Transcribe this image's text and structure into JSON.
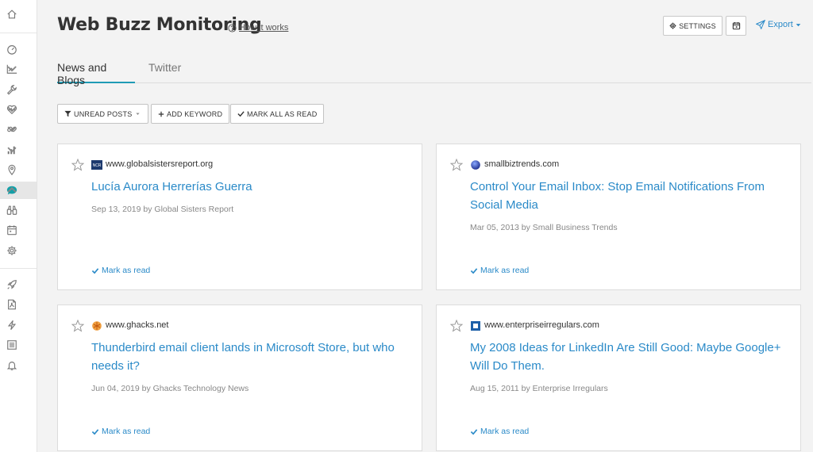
{
  "header": {
    "title": "Web Buzz Monitoring",
    "how_it_works": "How it works",
    "settings_label": "SETTINGS",
    "export_label": "Export"
  },
  "tabs": [
    {
      "label": "News and Blogs",
      "active": true
    },
    {
      "label": "Twitter",
      "active": false
    }
  ],
  "toolbar": {
    "filter_label": "UNREAD POSTS",
    "add_keyword_label": "ADD KEYWORD",
    "mark_all_label": "MARK ALL AS READ"
  },
  "sidebar": {
    "items": [
      {
        "icon": "home-icon"
      },
      {
        "icon": "dashboard-icon"
      },
      {
        "icon": "trend-chart-icon"
      },
      {
        "icon": "wrench-icon"
      },
      {
        "icon": "heart-pulse-icon"
      },
      {
        "icon": "link-icon"
      },
      {
        "icon": "bar-chart-icon"
      },
      {
        "icon": "map-pin-icon"
      },
      {
        "icon": "chat-bubble-icon",
        "active": true
      },
      {
        "icon": "binoculars-icon"
      },
      {
        "icon": "calendar-icon"
      },
      {
        "icon": "gear-icon"
      },
      {
        "icon": "rocket-icon"
      },
      {
        "icon": "pdf-icon"
      },
      {
        "icon": "bolt-icon"
      },
      {
        "icon": "list-icon"
      },
      {
        "icon": "bell-icon"
      }
    ]
  },
  "posts": [
    {
      "domain": "www.globalsistersreport.org",
      "favicon_text": "NCR",
      "title": "Lucía Aurora Herrerías Guerra",
      "meta": "Sep 13, 2019 by Global Sisters Report",
      "mark_label": "Mark as read"
    },
    {
      "domain": "smallbiztrends.com",
      "title": "Control Your Email Inbox: Stop Email Notifications From Social Media",
      "meta": "Mar 05, 2013 by Small Business Trends",
      "mark_label": "Mark as read"
    },
    {
      "domain": "www.ghacks.net",
      "title": "Thunderbird email client lands in Microsoft Store, but who needs it?",
      "meta": "Jun 04, 2019 by Ghacks Technology News",
      "mark_label": "Mark as read"
    },
    {
      "domain": "www.enterpriseirregulars.com",
      "title": "My 2008 Ideas for LinkedIn Are Still Good: Maybe Google+ Will Do Them.",
      "meta": "Aug 15, 2011 by Enterprise Irregulars",
      "mark_label": "Mark as read"
    }
  ],
  "colors": {
    "accent": "#2a8ac8",
    "tab_underline": "#1f9bb5",
    "active_chat_icon": "#16a0a8"
  }
}
